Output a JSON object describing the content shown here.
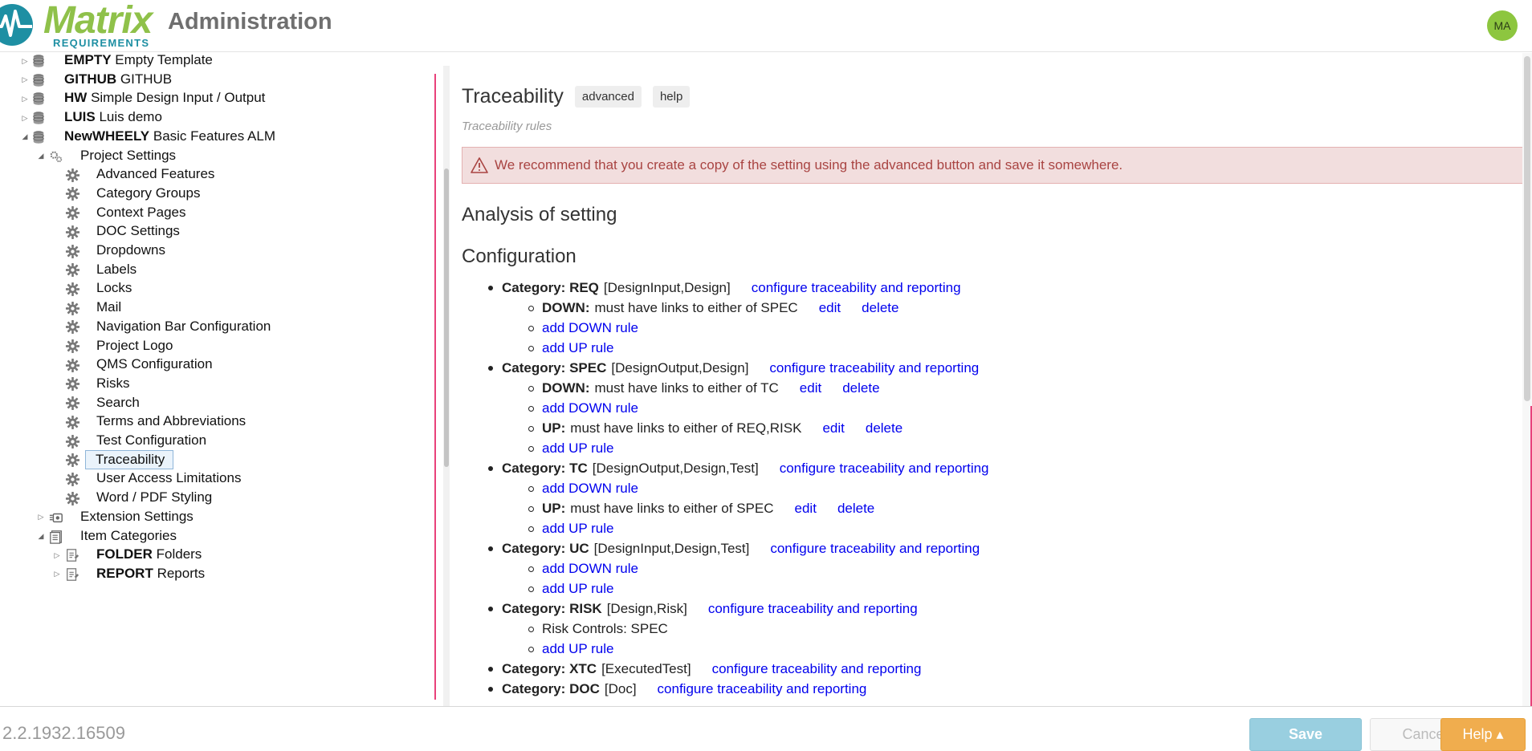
{
  "header": {
    "logo_word": "Matrix",
    "logo_sub": "REQUIREMENTS",
    "title": "Administration",
    "avatar_initials": "MA",
    "brand_green": "#8fc14a",
    "brand_teal": "#1e8fa3"
  },
  "sidebar": {
    "projects": [
      {
        "code": "EMPTY",
        "name": "Empty Template"
      },
      {
        "code": "GITHUB",
        "name": "GITHUB"
      },
      {
        "code": "HW",
        "name": "Simple Design Input / Output"
      },
      {
        "code": "LUIS",
        "name": "Luis demo"
      },
      {
        "code": "NewWHEELY",
        "name": "Basic Features ALM"
      }
    ],
    "project_settings_label": "Project Settings",
    "settings": [
      "Advanced Features",
      "Category Groups",
      "Context Pages",
      "DOC Settings",
      "Dropdowns",
      "Labels",
      "Locks",
      "Mail",
      "Navigation Bar Configuration",
      "Project Logo",
      "QMS Configuration",
      "Risks",
      "Search",
      "Terms and Abbreviations",
      "Test Configuration",
      "Traceability",
      "User Access Limitations",
      "Word / PDF Styling"
    ],
    "selected": "Traceability",
    "extension_settings_label": "Extension Settings",
    "item_categories_label": "Item Categories",
    "categories": [
      {
        "code": "FOLDER",
        "name": "Folders"
      },
      {
        "code": "REPORT",
        "name": "Reports"
      }
    ]
  },
  "main": {
    "title": "Traceability",
    "advanced_label": "advanced",
    "help_label": "help",
    "subtitle": "Traceability rules",
    "alert": "We recommend that you create a copy of the setting using the advanced button and save it somewhere.",
    "analysis_heading": "Analysis of setting",
    "config_heading": "Configuration",
    "configure_link": "configure traceability and reporting",
    "edit_link": "edit",
    "delete_link": "delete",
    "add_down": "add DOWN rule",
    "add_up": "add UP rule",
    "categories": [
      {
        "label": "Category: REQ",
        "groups": "[DesignInput,Design]",
        "rules": [
          {
            "kind": "DOWN:",
            "text": "must have links to either of SPEC"
          }
        ]
      },
      {
        "label": "Category: SPEC",
        "groups": "[DesignOutput,Design]",
        "rules": [
          {
            "kind": "DOWN:",
            "text": "must have links to either of TC"
          },
          {
            "kind": "UP:",
            "text": "must have links to either of REQ,RISK"
          }
        ]
      },
      {
        "label": "Category: TC",
        "groups": "[DesignOutput,Design,Test]",
        "rules": [
          {
            "kind": "UP:",
            "text": "must have links to either of SPEC"
          }
        ]
      },
      {
        "label": "Category: UC",
        "groups": "[DesignInput,Design,Test]",
        "rules": []
      },
      {
        "label": "Category: RISK",
        "groups": "[Design,Risk]",
        "risk_controls": "Risk Controls: SPEC"
      },
      {
        "label": "Category: XTC",
        "groups": "[ExecutedTest]"
      },
      {
        "label": "Category: DOC",
        "groups": "[Doc]"
      }
    ]
  },
  "footer": {
    "version": "2.2.1932.16509",
    "save_label": "Save",
    "cancel_label": "Cancel",
    "help_label": "Help ▴"
  },
  "colors": {
    "link": "#0000ee",
    "alert_bg": "#f2dede",
    "alert_text": "#a94442",
    "save_bg": "#99cfe0",
    "help_bg": "#f0ad4e"
  }
}
